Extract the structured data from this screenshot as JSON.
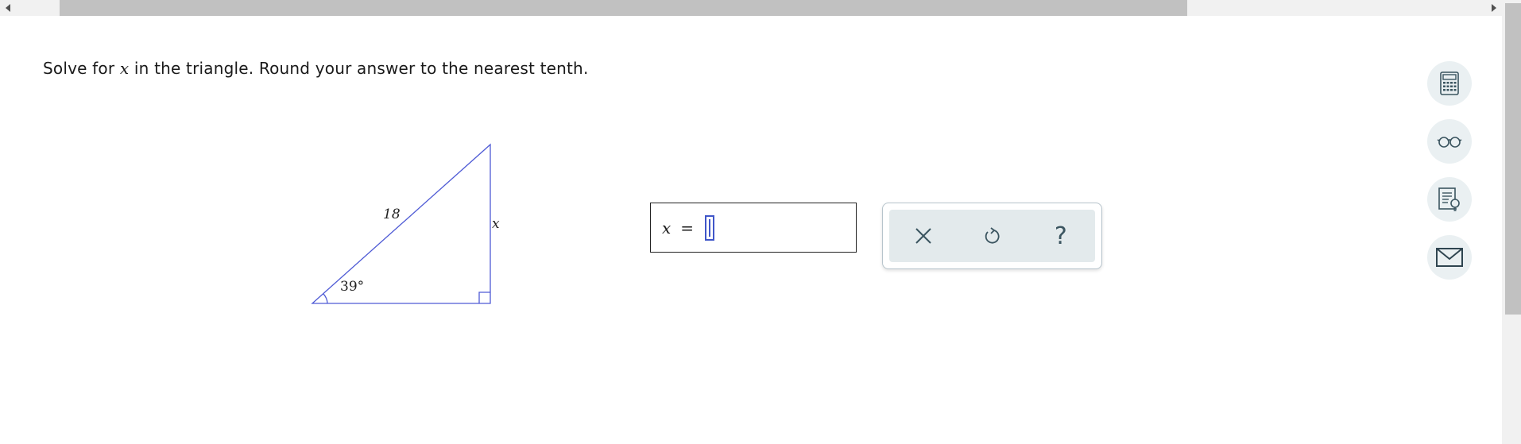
{
  "question": {
    "part1": "Solve for ",
    "variable": "x",
    "part2": " in the triangle. Round your answer to the nearest tenth."
  },
  "figure": {
    "hypotenuse_label": "18",
    "side_label": "x",
    "angle_label": "39°",
    "line_color": "#4f5bd5"
  },
  "answer": {
    "variable": "x",
    "equals": "=",
    "value": ""
  },
  "tools": {
    "clear_icon": "close-icon",
    "undo_icon": "undo-icon",
    "help_label": "?"
  },
  "side_toolbar": [
    {
      "icon": "calculator-icon"
    },
    {
      "icon": "glasses-icon"
    },
    {
      "icon": "textbook-icon"
    },
    {
      "icon": "mail-icon"
    }
  ],
  "colors": {
    "accent": "#4056c9",
    "icon": "#3b5560",
    "panel_bg": "#e3eaec"
  }
}
